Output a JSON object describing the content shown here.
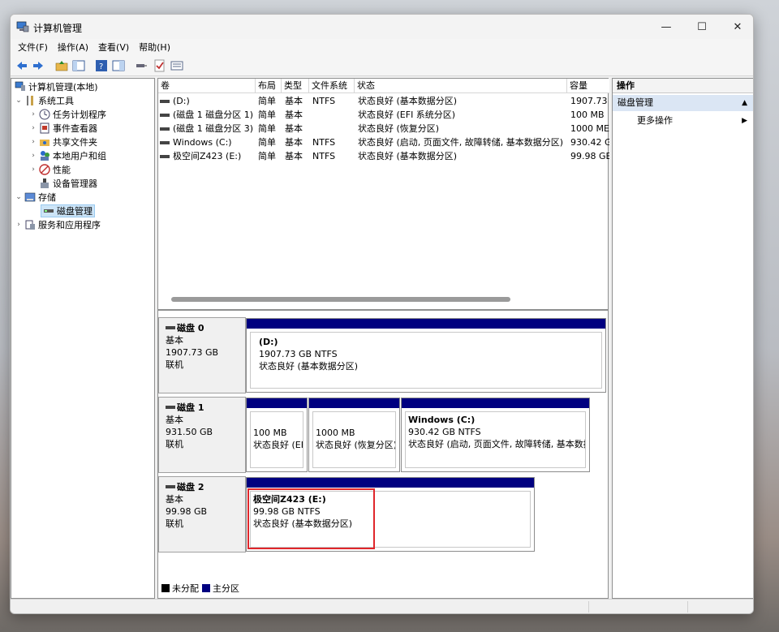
{
  "window": {
    "title": "计算机管理",
    "controls": {
      "minimize": "—",
      "maximize": "☐",
      "close": "✕"
    }
  },
  "menu": [
    "文件(F)",
    "操作(A)",
    "查看(V)",
    "帮助(H)"
  ],
  "tree": {
    "root": "计算机管理(本地)",
    "system_tools": "系统工具",
    "task_scheduler": "任务计划程序",
    "event_viewer": "事件查看器",
    "shared_folders": "共享文件夹",
    "local_users": "本地用户和组",
    "performance": "性能",
    "device_manager": "设备管理器",
    "storage": "存储",
    "disk_management": "磁盘管理",
    "services_apps": "服务和应用程序"
  },
  "volume_table": {
    "columns": [
      "卷",
      "布局",
      "类型",
      "文件系统",
      "状态",
      "容量"
    ],
    "rows": [
      [
        "(D:)",
        "简单",
        "基本",
        "NTFS",
        "状态良好 (基本数据分区)",
        "1907.73"
      ],
      [
        "(磁盘 1 磁盘分区 1)",
        "简单",
        "基本",
        "",
        "状态良好 (EFI 系统分区)",
        "100 MB"
      ],
      [
        "(磁盘 1 磁盘分区 3)",
        "简单",
        "基本",
        "",
        "状态良好 (恢复分区)",
        "1000 ME"
      ],
      [
        "Windows (C:)",
        "简单",
        "基本",
        "NTFS",
        "状态良好 (启动, 页面文件, 故障转储, 基本数据分区)",
        "930.42 G"
      ],
      [
        "极空间Z423 (E:)",
        "简单",
        "基本",
        "NTFS",
        "状态良好 (基本数据分区)",
        "99.98 GE"
      ]
    ]
  },
  "disks": {
    "disk0": {
      "name": "磁盘 0",
      "type": "基本",
      "size": "1907.73 GB",
      "status": "联机",
      "p1": {
        "title": "(D:)",
        "size": "1907.73 GB NTFS",
        "status": "状态良好 (基本数据分区)"
      }
    },
    "disk1": {
      "name": "磁盘 1",
      "type": "基本",
      "size": "931.50 GB",
      "status": "联机",
      "p1": {
        "size": "100 MB",
        "status": "状态良好 (EF"
      },
      "p2": {
        "size": "1000 MB",
        "status": "状态良好 (恢复分区)"
      },
      "p3": {
        "title": "Windows  (C:)",
        "size": "930.42 GB NTFS",
        "status": "状态良好 (启动, 页面文件, 故障转储, 基本数据"
      }
    },
    "disk2": {
      "name": "磁盘 2",
      "type": "基本",
      "size": "99.98 GB",
      "status": "联机",
      "p1": {
        "title": "极空间Z423  (E:)",
        "size": "99.98 GB NTFS",
        "status": "状态良好 (基本数据分区)"
      }
    }
  },
  "legend": {
    "unallocated": "未分配",
    "primary": "主分区"
  },
  "actions": {
    "title": "操作",
    "section": "磁盘管理",
    "more": "更多操作"
  },
  "colors": {
    "primary_partition": "#000080",
    "unallocated": "#000000",
    "highlight": "#e0262b"
  }
}
